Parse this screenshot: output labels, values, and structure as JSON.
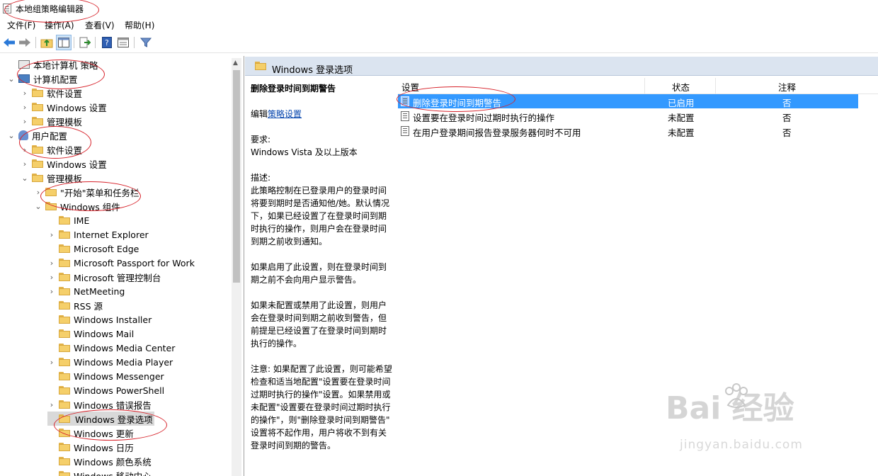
{
  "window": {
    "title": "本地组策略编辑器"
  },
  "menu": [
    "文件(F)",
    "操作(A)",
    "查看(V)",
    "帮助(H)"
  ],
  "tree": [
    {
      "label": "本地计算机 策略",
      "icon": "policy-icon",
      "level": 0,
      "chevron": ""
    },
    {
      "label": "计算机配置",
      "icon": "computer-icon",
      "level": 0,
      "chevron": "open"
    },
    {
      "label": "软件设置",
      "icon": "folder-icon",
      "level": 1,
      "chevron": "closed"
    },
    {
      "label": "Windows 设置",
      "icon": "folder-icon",
      "level": 1,
      "chevron": "closed"
    },
    {
      "label": "管理模板",
      "icon": "folder-icon",
      "level": 1,
      "chevron": "closed"
    },
    {
      "label": "用户配置",
      "icon": "user-icon",
      "level": 0,
      "chevron": "open"
    },
    {
      "label": "软件设置",
      "icon": "folder-icon",
      "level": 1,
      "chevron": "closed"
    },
    {
      "label": "Windows 设置",
      "icon": "folder-icon",
      "level": 1,
      "chevron": "closed"
    },
    {
      "label": "管理模板",
      "icon": "folder-icon",
      "level": 1,
      "chevron": "open"
    },
    {
      "label": "\"开始\"菜单和任务栏",
      "icon": "folder-icon",
      "level": 2,
      "chevron": "closed"
    },
    {
      "label": "Windows 组件",
      "icon": "folder-icon",
      "level": 2,
      "chevron": "open"
    },
    {
      "label": "IME",
      "icon": "folder-icon",
      "level": 3,
      "chevron": ""
    },
    {
      "label": "Internet Explorer",
      "icon": "folder-icon",
      "level": 3,
      "chevron": "closed"
    },
    {
      "label": "Microsoft Edge",
      "icon": "folder-icon",
      "level": 3,
      "chevron": ""
    },
    {
      "label": "Microsoft Passport for Work",
      "icon": "folder-icon",
      "level": 3,
      "chevron": "closed"
    },
    {
      "label": "Microsoft 管理控制台",
      "icon": "folder-icon",
      "level": 3,
      "chevron": "closed"
    },
    {
      "label": "NetMeeting",
      "icon": "folder-icon",
      "level": 3,
      "chevron": "closed"
    },
    {
      "label": "RSS 源",
      "icon": "folder-icon",
      "level": 3,
      "chevron": ""
    },
    {
      "label": "Windows Installer",
      "icon": "folder-icon",
      "level": 3,
      "chevron": ""
    },
    {
      "label": "Windows Mail",
      "icon": "folder-icon",
      "level": 3,
      "chevron": ""
    },
    {
      "label": "Windows Media Center",
      "icon": "folder-icon",
      "level": 3,
      "chevron": ""
    },
    {
      "label": "Windows Media Player",
      "icon": "folder-icon",
      "level": 3,
      "chevron": "closed"
    },
    {
      "label": "Windows Messenger",
      "icon": "folder-icon",
      "level": 3,
      "chevron": ""
    },
    {
      "label": "Windows PowerShell",
      "icon": "folder-icon",
      "level": 3,
      "chevron": ""
    },
    {
      "label": "Windows 错误报告",
      "icon": "folder-icon",
      "level": 3,
      "chevron": "closed"
    },
    {
      "label": "Windows 登录选项",
      "icon": "folder-icon",
      "level": 3,
      "chevron": "",
      "selected": true
    },
    {
      "label": "Windows 更新",
      "icon": "folder-icon",
      "level": 3,
      "chevron": ""
    },
    {
      "label": "Windows 日历",
      "icon": "folder-icon",
      "level": 3,
      "chevron": ""
    },
    {
      "label": "Windows 颜色系统",
      "icon": "folder-icon",
      "level": 3,
      "chevron": ""
    },
    {
      "label": "Windows 移动中心",
      "icon": "folder-icon",
      "level": 3,
      "chevron": ""
    }
  ],
  "right": {
    "header": "Windows 登录选项",
    "policy_title": "删除登录时间到期警告",
    "edit_prefix": "编辑",
    "edit_link": "策略设置",
    "requirement_label": "要求:",
    "requirement": "Windows Vista 及以上版本",
    "description_label": "描述:",
    "description_lines": [
      "此策略控制在已登录用户的登录时间",
      "将要到期时是否通知他/她。默认情况",
      "下，如果已经设置了在登录时间到期",
      "时执行的操作，则用户会在登录时间",
      "到期之前收到通知。",
      "",
      "如果启用了此设置，则在登录时间到",
      "期之前不会向用户显示警告。",
      "",
      "如果未配置或禁用了此设置，则用户",
      "会在登录时间到期之前收到警告，但",
      "前提是已经设置了在登录时间到期时",
      "执行的操作。",
      "",
      "注意: 如果配置了此设置，则可能希望",
      "检查和适当地配置\"设置要在登录时间",
      "过期时执行的操作\"设置。如果禁用或",
      "未配置\"设置要在登录时间过期时执行",
      "的操作\"，则\"删除登录时间到期警告\"",
      "设置将不起作用，用户将收不到有关",
      "登录时间到期的警告。"
    ],
    "columns": {
      "setting": "设置",
      "state": "状态",
      "comment": "注释"
    },
    "rows": [
      {
        "setting": "删除登录时间到期警告",
        "state": "已启用",
        "comment": "否",
        "selected": true
      },
      {
        "setting": "设置要在登录时间过期时执行的操作",
        "state": "未配置",
        "comment": "否"
      },
      {
        "setting": "在用户登录期间报告登录服务器何时不可用",
        "state": "未配置",
        "comment": "否"
      }
    ]
  },
  "watermark": {
    "brand": "Bai  经验",
    "url": "jingyan.baidu.com"
  },
  "colors": {
    "selection": "#3399ff",
    "annotation": "#d7232b",
    "header_bg": "#dbe4f0",
    "tree_selected": "#d9d9d9"
  }
}
